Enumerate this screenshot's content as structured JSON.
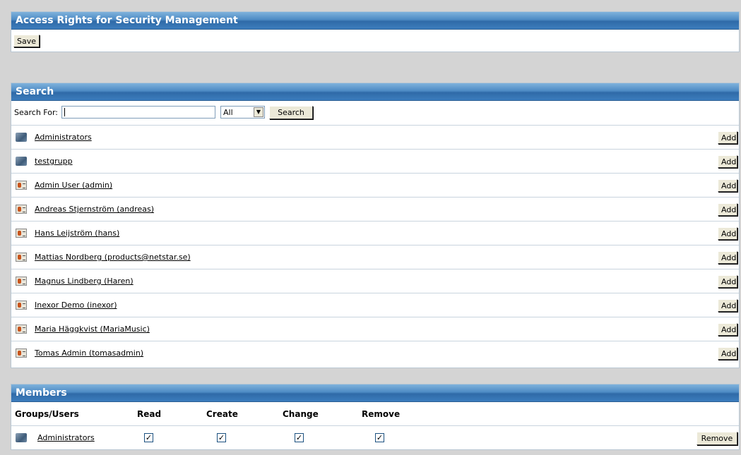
{
  "access": {
    "title": "Access Rights for Security Management",
    "save_label": "Save"
  },
  "search": {
    "title": "Search",
    "search_for_label": "Search For:",
    "input_value": "",
    "filter_selected": "All",
    "search_button": "Search",
    "add_label": "Add",
    "results": [
      {
        "name": "Administrators",
        "type": "group-icon"
      },
      {
        "name": "testgrupp",
        "type": "group-icon"
      },
      {
        "name": "Admin User (admin)",
        "type": "user-icon"
      },
      {
        "name": "Andreas Stjernström (andreas)",
        "type": "user-icon"
      },
      {
        "name": "Hans Leijström (hans)",
        "type": "user-icon"
      },
      {
        "name": "Mattias Nordberg (products@netstar.se)",
        "type": "user-icon"
      },
      {
        "name": "Magnus Lindberg (Haren)",
        "type": "user-icon"
      },
      {
        "name": "Inexor Demo (inexor)",
        "type": "user-icon"
      },
      {
        "name": "Maria Häggkvist (MariaMusic)",
        "type": "user-icon"
      },
      {
        "name": "Tomas Admin (tomasadmin)",
        "type": "user-icon"
      }
    ]
  },
  "members": {
    "title": "Members",
    "columns": [
      "Groups/Users",
      "Read",
      "Create",
      "Change",
      "Remove"
    ],
    "remove_label": "Remove",
    "rows": [
      {
        "name": "Administrators",
        "type": "group-icon",
        "read": true,
        "create": true,
        "change": true,
        "remove": true
      }
    ]
  },
  "colors": {
    "header_blue": "#3c7dbd",
    "background": "#d4d4d4"
  }
}
